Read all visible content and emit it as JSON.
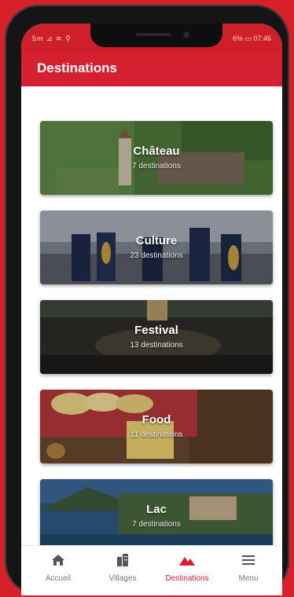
{
  "status": {
    "left": "5m ⊿ ≋ ⚲",
    "right": "6% ▭ 07:46"
  },
  "header": {
    "title": "Destinations"
  },
  "categories": [
    {
      "name": "Château",
      "count": "7 destinations"
    },
    {
      "name": "Culture",
      "count": "23 destinations"
    },
    {
      "name": "Festival",
      "count": "13 destinations"
    },
    {
      "name": "Food",
      "count": "11 destinations"
    },
    {
      "name": "Lac",
      "count": "7 destinations"
    }
  ],
  "nav": [
    {
      "label": "Accueil",
      "icon": "home-icon"
    },
    {
      "label": "Villages",
      "icon": "buildings-icon"
    },
    {
      "label": "Destinations",
      "icon": "mountains-icon",
      "active": true
    },
    {
      "label": "Menu",
      "icon": "menu-icon"
    }
  ],
  "colors": {
    "brand": "#d42030",
    "inactive": "#777777"
  }
}
